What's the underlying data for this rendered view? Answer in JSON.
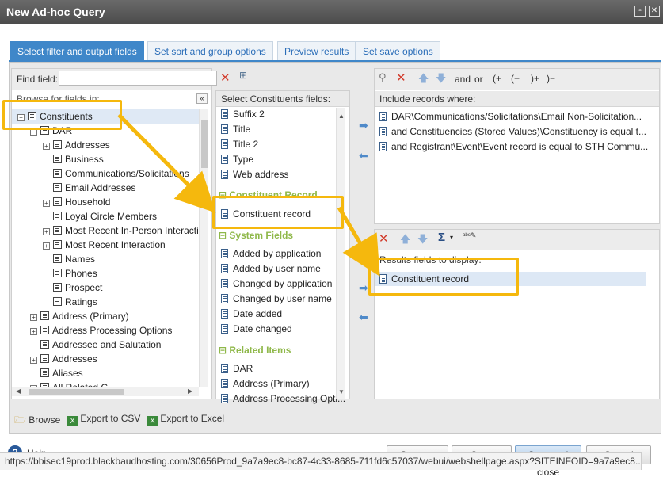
{
  "window": {
    "title": "New Ad-hoc Query"
  },
  "tabs": [
    "Select filter and output fields",
    "Set sort and group options",
    "Preview results",
    "Set save options"
  ],
  "left": {
    "find_label": "Find field:",
    "find_value": "",
    "browse_label": "Browse for fields in:",
    "root": "Constituents",
    "tree": [
      {
        "label": "DAR",
        "expand": "-",
        "indent": 1
      },
      {
        "label": "Addresses",
        "expand": "+",
        "indent": 2
      },
      {
        "label": "Business",
        "expand": "",
        "indent": 2
      },
      {
        "label": "Communications/Solicitations",
        "expand": "",
        "indent": 2
      },
      {
        "label": "Email Addresses",
        "expand": "",
        "indent": 2
      },
      {
        "label": "Household",
        "expand": "+",
        "indent": 2
      },
      {
        "label": "Loyal Circle Members",
        "expand": "",
        "indent": 2
      },
      {
        "label": "Most Recent In-Person Interacti",
        "expand": "+",
        "indent": 2
      },
      {
        "label": "Most Recent Interaction",
        "expand": "+",
        "indent": 2
      },
      {
        "label": "Names",
        "expand": "",
        "indent": 2
      },
      {
        "label": "Phones",
        "expand": "",
        "indent": 2
      },
      {
        "label": "Prospect",
        "expand": "",
        "indent": 2
      },
      {
        "label": "Ratings",
        "expand": "",
        "indent": 2
      },
      {
        "label": "Address (Primary)",
        "expand": "+",
        "indent": 1
      },
      {
        "label": "Address Processing Options",
        "expand": "+",
        "indent": 1
      },
      {
        "label": "Addressee and Salutation",
        "expand": "",
        "indent": 1
      },
      {
        "label": "Addresses",
        "expand": "+",
        "indent": 1
      },
      {
        "label": "Aliases",
        "expand": "",
        "indent": 1
      },
      {
        "label": "All Related C...",
        "expand": "+",
        "indent": 1
      }
    ]
  },
  "middle": {
    "header": "Select Constituents fields:",
    "top_fields": [
      "Suffix 2",
      "Title",
      "Title 2",
      "Type",
      "Web address"
    ],
    "section_constituent": "Constituent Record",
    "constituent_fields": [
      "Constituent record"
    ],
    "section_system": "System Fields",
    "system_fields": [
      "Added by application",
      "Added by user name",
      "Changed by application",
      "Changed by user name",
      "Date added",
      "Date changed"
    ],
    "section_related": "Related Items",
    "related_fields": [
      "DAR",
      "Address (Primary)",
      "Address Processing Opti..."
    ]
  },
  "filter": {
    "toolbar": {
      "and": "and",
      "or": "or",
      "open1": "(+",
      "open2": "(−",
      "close1": ")+",
      "close2": ")−"
    },
    "header": "Include records where:",
    "items": [
      "DAR\\Communications/Solicitations\\Email Non-Solicitation...",
      "and Constituencies (Stored Values)\\Constituency is equal t...",
      "and Registrant\\Event\\Event record is equal to STH Commu..."
    ]
  },
  "output": {
    "header": "Results fields to display:",
    "items": [
      "Constituent record"
    ]
  },
  "bottom_links": {
    "browse": "Browse",
    "export_csv": "Export to CSV",
    "export_excel": "Export to Excel"
  },
  "footer": {
    "help": "Help",
    "save_as": "Save as",
    "save": "Save",
    "save_close": "Save and close",
    "cancel": "Cancel"
  },
  "status_url": "https://bbisec19prod.blackbaudhosting.com/30656Prod_9a7a9ec8-bc87-4c33-8685-711fd6c57037/webui/webshellpage.aspx?SITEINFOID=9a7a9ec8...",
  "colors": {
    "accent": "#3f87c9",
    "highlight": "#f5b80d",
    "section": "#8fb84a"
  }
}
